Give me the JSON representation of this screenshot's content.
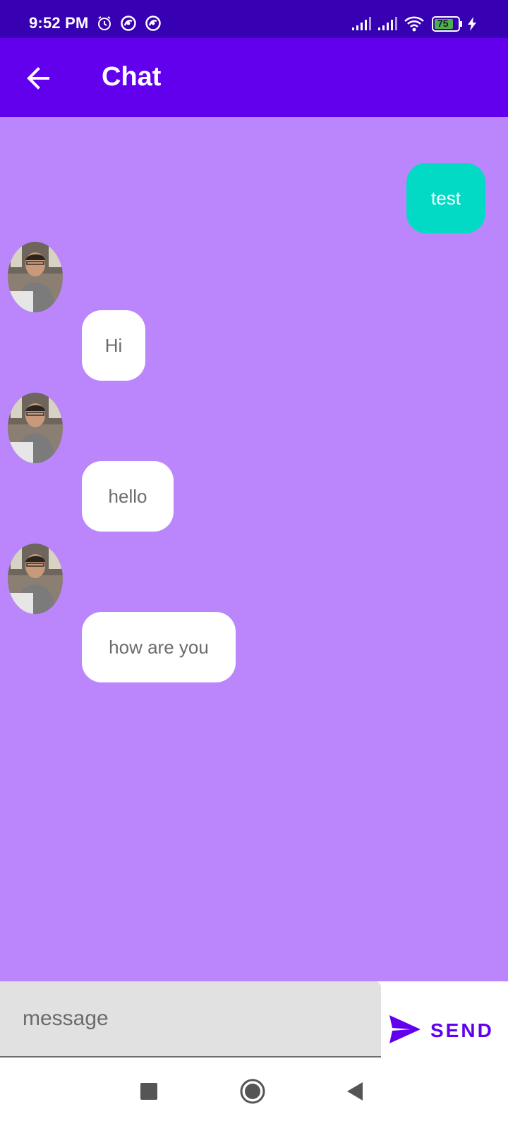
{
  "status_bar": {
    "time": "9:52 PM",
    "battery": "75",
    "icons": [
      "alarm-icon",
      "sync-icon",
      "sync-icon",
      "signal-icon",
      "signal-icon",
      "wifi-icon",
      "battery-icon",
      "charging-icon"
    ]
  },
  "app_bar": {
    "title": "Chat",
    "back_icon": "arrow-back-icon"
  },
  "messages": [
    {
      "direction": "sent",
      "text": "test"
    },
    {
      "direction": "received",
      "text": "Hi",
      "avatar": "user-avatar"
    },
    {
      "direction": "received",
      "text": "hello",
      "avatar": "user-avatar"
    },
    {
      "direction": "received",
      "text": "how are you",
      "avatar": "user-avatar"
    }
  ],
  "composer": {
    "placeholder": "message",
    "value": "",
    "send_label": "SEND",
    "send_icon": "send-icon"
  },
  "nav_bar": {
    "buttons": [
      "recents-icon",
      "home-icon",
      "back-icon"
    ]
  },
  "colors": {
    "status_bar": "#3700B3",
    "app_bar": "#6200EE",
    "chat_background": "#BB86FC",
    "sent_bubble": "#03DAC5",
    "received_bubble": "#FFFFFF",
    "accent": "#6200EE"
  }
}
